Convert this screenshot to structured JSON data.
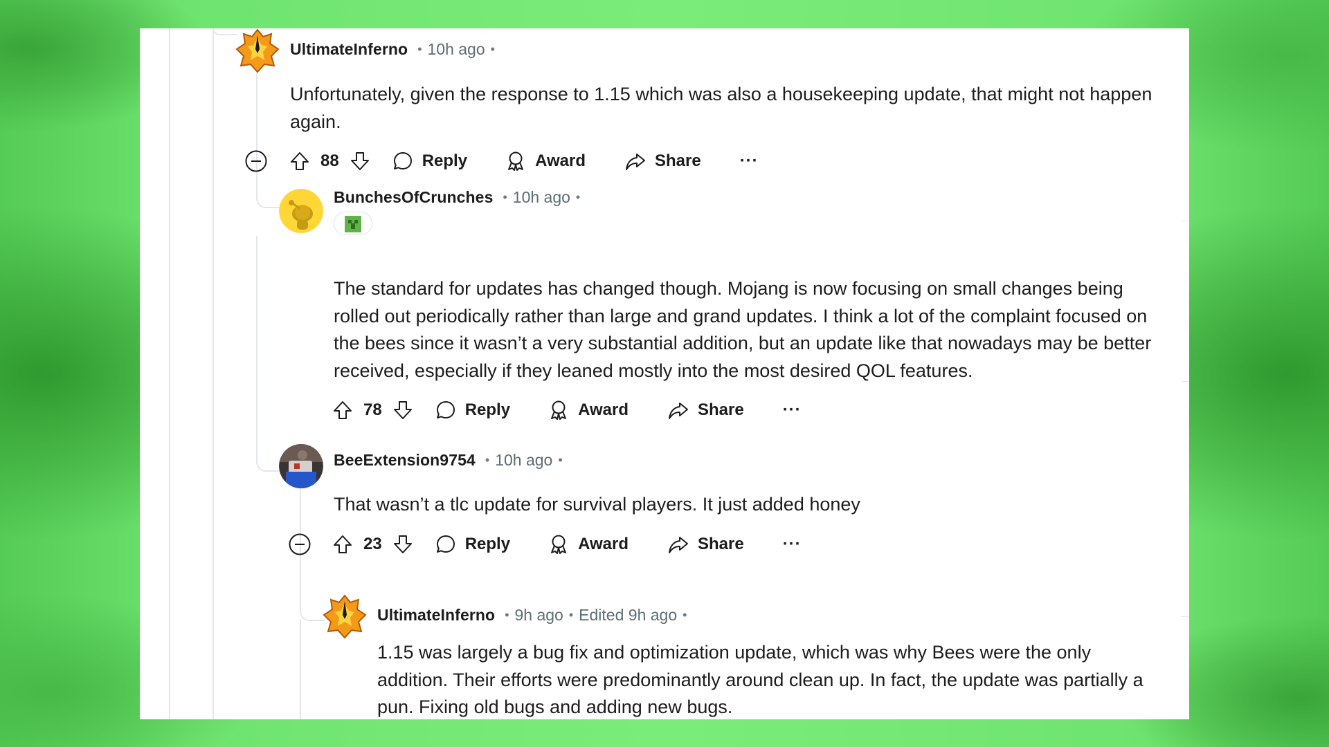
{
  "colors": {
    "background_green": "#7aec7a",
    "card": "#ffffff",
    "thread_line": "#e3e6e8",
    "meta_text": "#5d6d74"
  },
  "comments": [
    {
      "username": "UltimateInferno",
      "time": "10h ago",
      "text": "Unfortunately, given the response to 1.15 which was also a housekeeping update, that might not happen again.",
      "score": "88",
      "reply_label": "Reply",
      "award_label": "Award",
      "share_label": "Share",
      "more_label": "···",
      "avatar_icon": "flame-emblem-avatar-icon"
    },
    {
      "username": "BunchesOfCrunches",
      "time": "10h ago",
      "flair_icon": "creeper-flair-icon",
      "text": "The standard for updates has changed though. Mojang is now focusing on small changes being rolled out periodically rather than large and grand updates. I think a lot of the complaint focused on the bees since it wasn’t a very substantial addition, but an update like that nowadays may be better received, especially if they leaned mostly into the most desired QOL features.",
      "score": "78",
      "reply_label": "Reply",
      "award_label": "Award",
      "share_label": "Share",
      "more_label": "···",
      "avatar_icon": "snoo-avatar-icon"
    },
    {
      "username": "BeeExtension9754",
      "time": "10h ago",
      "text": "That wasn’t a tlc update for survival players. It just added honey",
      "score": "23",
      "reply_label": "Reply",
      "award_label": "Award",
      "share_label": "Share",
      "more_label": "···",
      "avatar_icon": "photo-avatar-icon"
    },
    {
      "username": "UltimateInferno",
      "time": "9h ago",
      "edited": "Edited 9h ago",
      "text": "1.15 was largely a bug fix and optimization update, which was why Bees were the only addition. Their efforts were predominantly around clean up. In fact, the update was partially a pun. Fixing old bugs and adding new bugs.",
      "avatar_icon": "flame-emblem-avatar-icon"
    }
  ]
}
